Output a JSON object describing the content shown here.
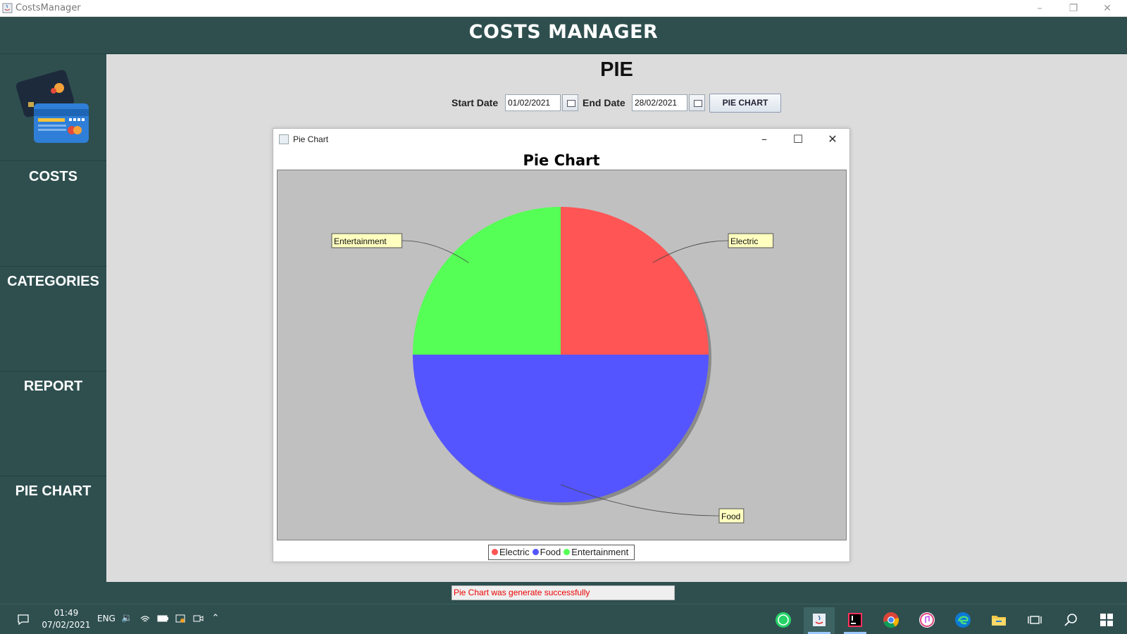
{
  "window": {
    "title": "CostsManager",
    "minimize": "–",
    "restore": "❐",
    "close": "✕"
  },
  "header": {
    "title": "COSTS MANAGER"
  },
  "sidebar": {
    "items": [
      {
        "label": "COSTS"
      },
      {
        "label": "CATEGORIES"
      },
      {
        "label": "REPORT"
      },
      {
        "label": "PIE CHART"
      }
    ]
  },
  "page": {
    "title": "PIE",
    "start_label": "Start Date",
    "start_value": "01/02/2021",
    "end_label": "End Date",
    "end_value": "28/02/2021",
    "button_label": "PIE CHART"
  },
  "chart_window": {
    "title": "Pie Chart",
    "minimize": "–",
    "maximize": "☐",
    "close": "✕"
  },
  "chart_data": {
    "type": "pie",
    "title": "Pie Chart",
    "categories": [
      "Electric",
      "Food",
      "Entertainment"
    ],
    "values": [
      25,
      50,
      25
    ],
    "colors": [
      "#ff5555",
      "#5555ff",
      "#55ff55"
    ],
    "legend": "bottom"
  },
  "status": {
    "message": "Pie Chart was generate successfully"
  },
  "taskbar": {
    "time": "01:49",
    "date": "07/02/2021",
    "lang": "ENG",
    "apps": [
      "whatsapp-icon",
      "java-icon",
      "intellij-icon",
      "chrome-icon",
      "itunes-icon",
      "edge-icon",
      "file-explorer-icon",
      "task-view-icon",
      "search-icon",
      "windows-start-icon"
    ]
  }
}
